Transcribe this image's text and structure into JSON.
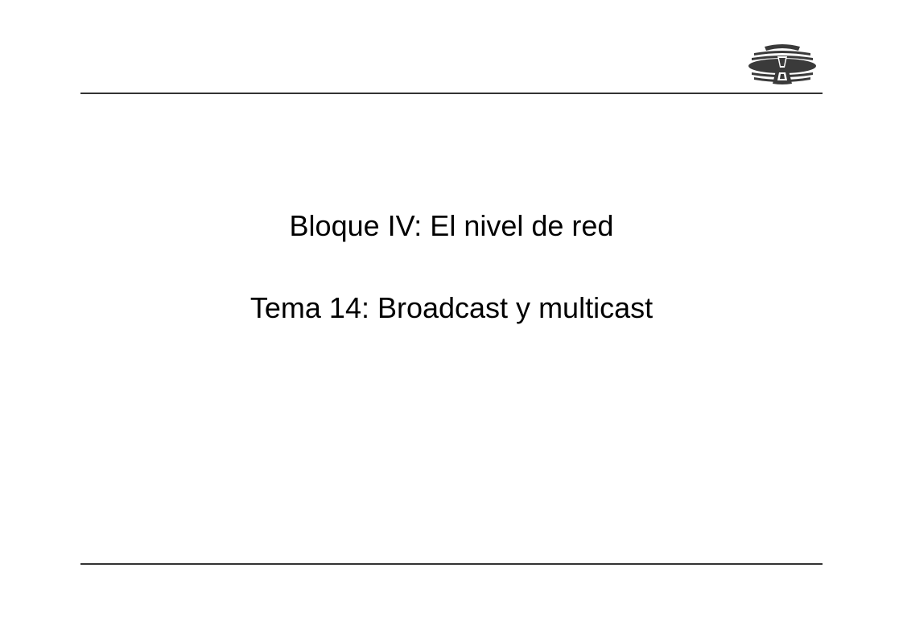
{
  "slide": {
    "block_title": "Bloque IV: El nivel de red",
    "topic_title": "Tema 14: Broadcast y multicast"
  },
  "logo": {
    "name": "institution-emblem-icon"
  }
}
